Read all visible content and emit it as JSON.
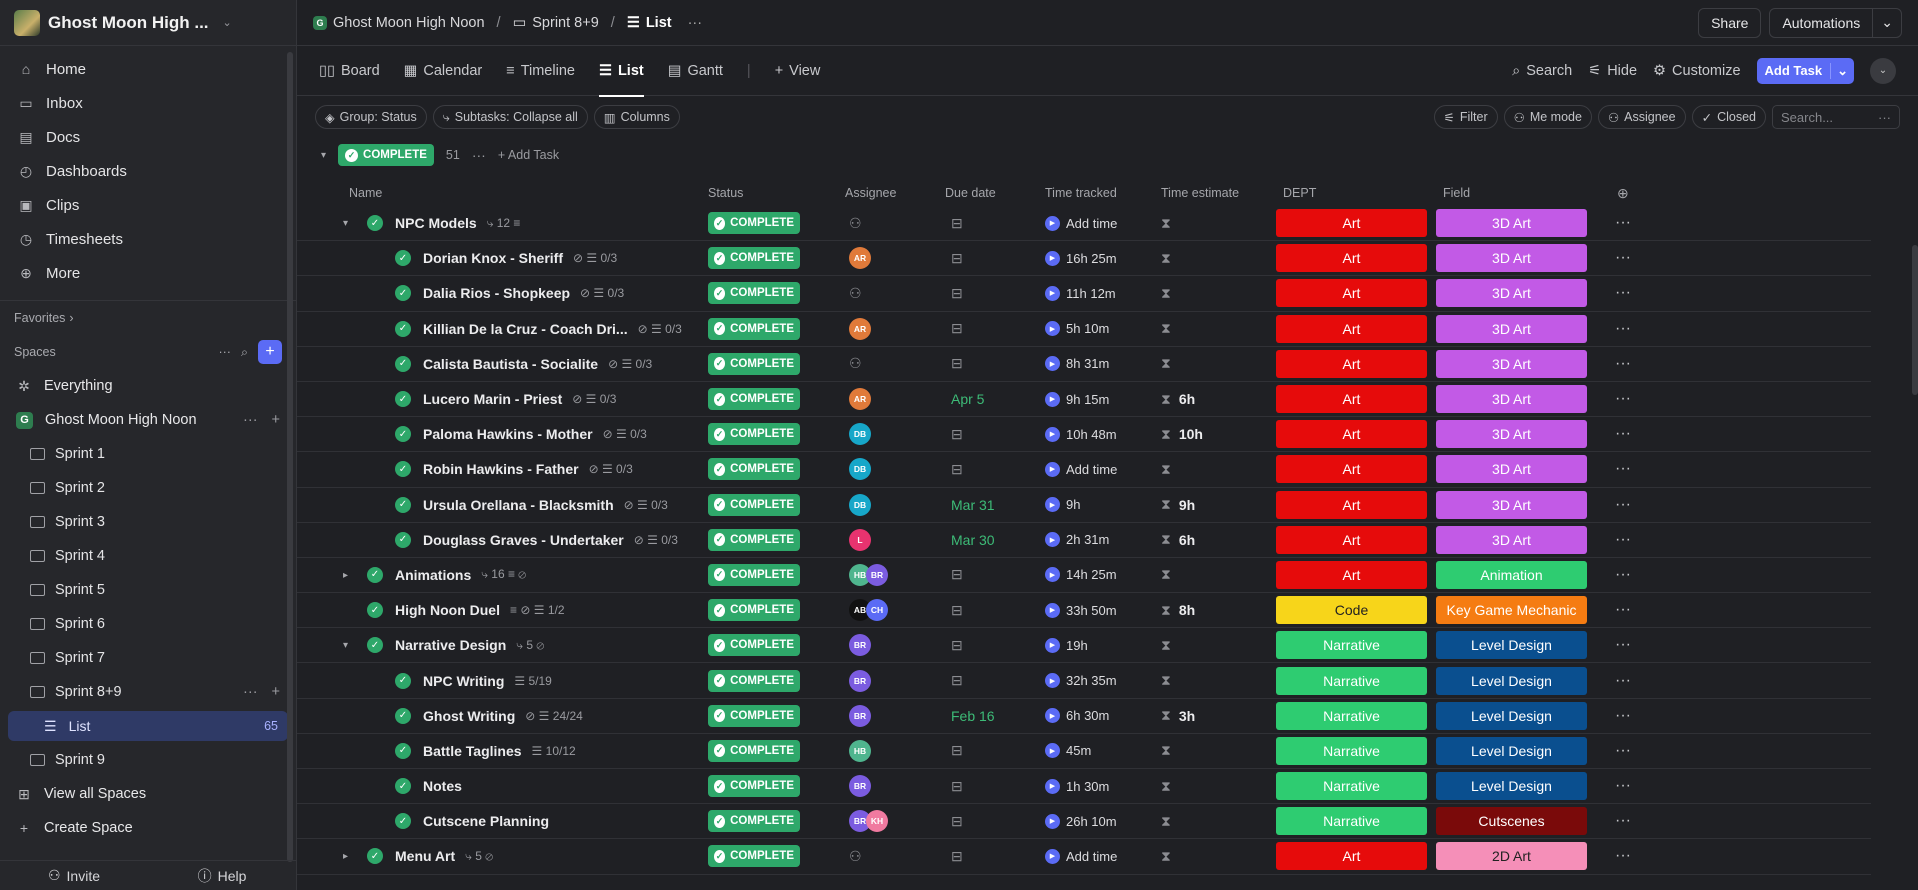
{
  "workspace": {
    "name": "Ghost Moon High ..."
  },
  "nav": [
    {
      "label": "Home",
      "icon": "home-icon",
      "glyph": "⌂"
    },
    {
      "label": "Inbox",
      "icon": "inbox-icon",
      "glyph": "▭"
    },
    {
      "label": "Docs",
      "icon": "docs-icon",
      "glyph": "▤"
    },
    {
      "label": "Dashboards",
      "icon": "dashboards-icon",
      "glyph": "◴"
    },
    {
      "label": "Clips",
      "icon": "clips-icon",
      "glyph": "▣"
    },
    {
      "label": "Timesheets",
      "icon": "timesheets-icon",
      "glyph": "◷"
    },
    {
      "label": "More",
      "icon": "more-icon",
      "glyph": "⊕"
    }
  ],
  "sidebar": {
    "favorites": "Favorites",
    "spaces": "Spaces",
    "everything": "Everything",
    "space_name": "Ghost Moon High Noon",
    "space_badge": "G",
    "folders": [
      "Sprint 1",
      "Sprint 2",
      "Sprint 3",
      "Sprint 4",
      "Sprint 5",
      "Sprint 6",
      "Sprint 7",
      "Sprint 8+9"
    ],
    "list": {
      "label": "List",
      "count": "65"
    },
    "after": "Sprint 9",
    "view_all": "View all Spaces",
    "create": "Create Space",
    "invite": "Invite",
    "help": "Help"
  },
  "topbar": {
    "crumb1": "Ghost Moon High Noon",
    "crumb2": "Sprint 8+9",
    "crumb3": "List",
    "share": "Share",
    "automations": "Automations"
  },
  "views": {
    "tabs": [
      "Board",
      "Calendar",
      "Timeline",
      "List",
      "Gantt"
    ],
    "tab_icons": [
      "▯▯",
      "▦",
      "≡",
      "☰",
      "▤"
    ],
    "add_view": "View",
    "search": "Search",
    "hide": "Hide",
    "customize": "Customize",
    "add_task": "Add Task"
  },
  "filters": {
    "group": "Group: Status",
    "subtasks": "Subtasks: Collapse all",
    "columns": "Columns",
    "filter": "Filter",
    "me_mode": "Me mode",
    "assignee": "Assignee",
    "closed": "Closed",
    "search_placeholder": "Search..."
  },
  "group": {
    "status": "COMPLETE",
    "count": "51",
    "add_task": "Add Task"
  },
  "columns": [
    "Name",
    "Status",
    "Assignee",
    "Due date",
    "Time tracked",
    "Time estimate",
    "DEPT",
    "Field"
  ],
  "colors": {
    "complete": "#2ea86a",
    "accent": "#5b6bf5",
    "art": "#e60b0b",
    "narrative": "#2ecc71",
    "code": "#f7d51a",
    "3d_art": "#c25ae6",
    "animation": "#2ecc71",
    "key_game_mechanic": "#f57c12",
    "level_design": "#0a4f8f",
    "cutscenes": "#7a0a0a",
    "2d_art": "#f58fb8"
  },
  "rows": [
    {
      "name": "NPC Models",
      "level": 0,
      "caret": "▾",
      "meta": "⤷ 12  ≡",
      "status": "COMPLETE",
      "assignees": [],
      "due": "",
      "time": "Add time",
      "est": "",
      "dept": "Art",
      "field": "3D Art"
    },
    {
      "name": "Dorian Knox - Sheriff",
      "level": 1,
      "caret": "",
      "meta": "⊘  ☰ 0/3",
      "status": "COMPLETE",
      "assignees": [
        {
          "i": "AR",
          "c": "#e07a3a"
        }
      ],
      "due": "",
      "time": "16h 25m",
      "est": "",
      "dept": "Art",
      "field": "3D Art"
    },
    {
      "name": "Dalia Rios - Shopkeep",
      "level": 1,
      "caret": "",
      "meta": "⊘  ☰ 0/3",
      "status": "COMPLETE",
      "assignees": [],
      "due": "",
      "time": "11h 12m",
      "est": "",
      "dept": "Art",
      "field": "3D Art"
    },
    {
      "name": "Killian De la Cruz - Coach Dri...",
      "level": 1,
      "caret": "",
      "meta": "⊘  ☰ 0/3",
      "status": "COMPLETE",
      "assignees": [
        {
          "i": "AR",
          "c": "#e07a3a"
        }
      ],
      "due": "",
      "time": "5h 10m",
      "est": "",
      "dept": "Art",
      "field": "3D Art"
    },
    {
      "name": "Calista Bautista - Socialite",
      "level": 1,
      "caret": "",
      "meta": "⊘  ☰ 0/3",
      "status": "COMPLETE",
      "assignees": [],
      "due": "",
      "time": "8h 31m",
      "est": "",
      "dept": "Art",
      "field": "3D Art"
    },
    {
      "name": "Lucero Marin - Priest",
      "level": 1,
      "caret": "",
      "meta": "⊘  ☰ 0/3",
      "status": "COMPLETE",
      "assignees": [
        {
          "i": "AR",
          "c": "#e07a3a"
        }
      ],
      "due": "Apr 5",
      "time": "9h 15m",
      "est": "6h",
      "dept": "Art",
      "field": "3D Art"
    },
    {
      "name": "Paloma Hawkins - Mother",
      "level": 1,
      "caret": "",
      "meta": "⊘  ☰ 0/3",
      "status": "COMPLETE",
      "assignees": [
        {
          "i": "DB",
          "c": "#17a7c9"
        }
      ],
      "due": "",
      "time": "10h 48m",
      "est": "10h",
      "dept": "Art",
      "field": "3D Art"
    },
    {
      "name": "Robin Hawkins - Father",
      "level": 1,
      "caret": "",
      "meta": "⊘  ☰ 0/3",
      "status": "COMPLETE",
      "assignees": [
        {
          "i": "DB",
          "c": "#17a7c9"
        }
      ],
      "due": "",
      "time": "Add time",
      "est": "",
      "dept": "Art",
      "field": "3D Art"
    },
    {
      "name": "Ursula Orellana - Blacksmith",
      "level": 1,
      "caret": "",
      "meta": "⊘  ☰ 0/3",
      "status": "COMPLETE",
      "assignees": [
        {
          "i": "DB",
          "c": "#17a7c9"
        }
      ],
      "due": "Mar 31",
      "time": "9h",
      "est": "9h",
      "dept": "Art",
      "field": "3D Art"
    },
    {
      "name": "Douglass Graves - Undertaker",
      "level": 1,
      "caret": "",
      "meta": "⊘  ☰ 0/3",
      "status": "COMPLETE",
      "assignees": [
        {
          "i": "L",
          "c": "#e8336f"
        }
      ],
      "due": "Mar 30",
      "time": "2h 31m",
      "est": "6h",
      "dept": "Art",
      "field": "3D Art"
    },
    {
      "name": "Animations",
      "level": 0,
      "caret": "▸",
      "meta": "⤷ 16  ≡  ⊘",
      "status": "COMPLETE",
      "assignees": [
        {
          "i": "HB",
          "c": "#4fb58e"
        },
        {
          "i": "BR",
          "c": "#7b5ce0"
        }
      ],
      "due": "",
      "time": "14h 25m",
      "est": "",
      "dept": "Art",
      "field": "Animation"
    },
    {
      "name": "High Noon Duel",
      "level": 0,
      "caret": "",
      "meta": "≡  ⊘  ☰ 1/2",
      "status": "COMPLETE",
      "assignees": [
        {
          "i": "AB",
          "c": "#111111"
        },
        {
          "i": "CH",
          "c": "#5b6bf5"
        }
      ],
      "due": "",
      "time": "33h 50m",
      "est": "8h",
      "dept": "Code",
      "field": "Key Game Mechanic"
    },
    {
      "name": "Narrative Design",
      "level": 0,
      "caret": "▾",
      "meta": "⤷ 5  ⊘",
      "status": "COMPLETE",
      "assignees": [
        {
          "i": "BR",
          "c": "#7b5ce0"
        }
      ],
      "due": "",
      "time": "19h",
      "est": "",
      "dept": "Narrative",
      "field": "Level Design"
    },
    {
      "name": "NPC Writing",
      "level": 1,
      "caret": "",
      "meta": "☰ 5/19",
      "status": "COMPLETE",
      "assignees": [
        {
          "i": "BR",
          "c": "#7b5ce0"
        }
      ],
      "due": "",
      "time": "32h 35m",
      "est": "",
      "dept": "Narrative",
      "field": "Level Design"
    },
    {
      "name": "Ghost Writing",
      "level": 1,
      "caret": "",
      "meta": "⊘  ☰ 24/24",
      "status": "COMPLETE",
      "assignees": [
        {
          "i": "BR",
          "c": "#7b5ce0"
        }
      ],
      "due": "Feb 16",
      "time": "6h 30m",
      "est": "3h",
      "dept": "Narrative",
      "field": "Level Design"
    },
    {
      "name": "Battle Taglines",
      "level": 1,
      "caret": "",
      "meta": "☰ 10/12",
      "status": "COMPLETE",
      "assignees": [
        {
          "i": "HB",
          "c": "#4fb58e"
        }
      ],
      "due": "",
      "time": "45m",
      "est": "",
      "dept": "Narrative",
      "field": "Level Design"
    },
    {
      "name": "Notes",
      "level": 1,
      "caret": "",
      "meta": "",
      "status": "COMPLETE",
      "assignees": [
        {
          "i": "BR",
          "c": "#7b5ce0"
        }
      ],
      "due": "",
      "time": "1h 30m",
      "est": "",
      "dept": "Narrative",
      "field": "Level Design"
    },
    {
      "name": "Cutscene Planning",
      "level": 1,
      "caret": "",
      "meta": "",
      "status": "COMPLETE",
      "assignees": [
        {
          "i": "BR",
          "c": "#7b5ce0"
        },
        {
          "i": "KH",
          "c": "#f07aa0"
        }
      ],
      "due": "",
      "time": "26h 10m",
      "est": "",
      "dept": "Narrative",
      "field": "Cutscenes"
    },
    {
      "name": "Menu Art",
      "level": 0,
      "caret": "▸",
      "meta": "⤷ 5  ⊘",
      "status": "COMPLETE",
      "assignees": [],
      "due": "",
      "time": "Add time",
      "est": "",
      "dept": "Art",
      "field": "2D Art"
    }
  ]
}
